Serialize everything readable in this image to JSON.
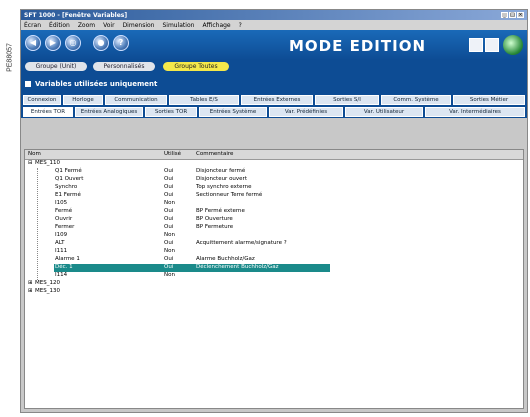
{
  "side_code": "PE88057",
  "window": {
    "title": "SFT 1000 - [Fenêtre Variables]"
  },
  "menubar": [
    "Écran",
    "Édition",
    "Zoom",
    "Voir",
    "Dimension",
    "Simulation",
    "Affichage",
    "?"
  ],
  "toolbar": {
    "mode_title": "MODE EDITION",
    "help_glyph": "?"
  },
  "selectors": [
    {
      "label": "Groupe (Unit)",
      "active": false
    },
    {
      "label": "Personnalisés",
      "active": false
    },
    {
      "label": "Groupe Toutes",
      "active": true
    }
  ],
  "section_title": "Variables utilisées uniquement",
  "tabs_row1": [
    "Connexion",
    "Horloge",
    "Communication",
    "Tables E/S",
    "Entrées Externes",
    "Sorties S/I",
    "Comm. Système",
    "Sorties Métier"
  ],
  "tabs_row2": [
    "Entrées TOR",
    "Entrées Analogiques",
    "Sorties TOR",
    "Entrées Système",
    "Var. Prédéfinies",
    "Var. Utilisateur",
    "Var. Intermédiaires"
  ],
  "columns": {
    "name": "Nom",
    "used": "Utilisé",
    "comment": "Commentaire"
  },
  "tree": {
    "root1": "MES_110",
    "items": [
      {
        "name": "Q1 Fermé",
        "used": "Oui",
        "comment": "Disjoncteur fermé"
      },
      {
        "name": "Q1 Ouvert",
        "used": "Oui",
        "comment": "Disjoncteur ouvert"
      },
      {
        "name": "Synchro",
        "used": "Oui",
        "comment": "Top synchro externe"
      },
      {
        "name": "E1 Fermé",
        "used": "Oui",
        "comment": "Sectionneur Terre fermé"
      },
      {
        "name": "I105",
        "used": "Non",
        "comment": ""
      },
      {
        "name": "Fermé",
        "used": "Oui",
        "comment": "BP Fermé externe"
      },
      {
        "name": "Ouvrir",
        "used": "Oui",
        "comment": "BP Ouverture"
      },
      {
        "name": "Fermer",
        "used": "Oui",
        "comment": "BP Fermeture"
      },
      {
        "name": "I109",
        "used": "Non",
        "comment": ""
      },
      {
        "name": "ALT",
        "used": "Oui",
        "comment": "Acquittement alarme/signature ?"
      },
      {
        "name": "I111",
        "used": "Non",
        "comment": ""
      },
      {
        "name": "Alarme 1",
        "used": "Oui",
        "comment": "Alarme Buchholz/Gaz"
      },
      {
        "name": "Déc. 1",
        "used": "Oui",
        "comment": "Déclenchement Buchholz/Gaz",
        "selected": true
      },
      {
        "name": "I114",
        "used": "Non",
        "comment": ""
      }
    ],
    "collapsed": [
      "MES_120",
      "MES_130"
    ]
  }
}
